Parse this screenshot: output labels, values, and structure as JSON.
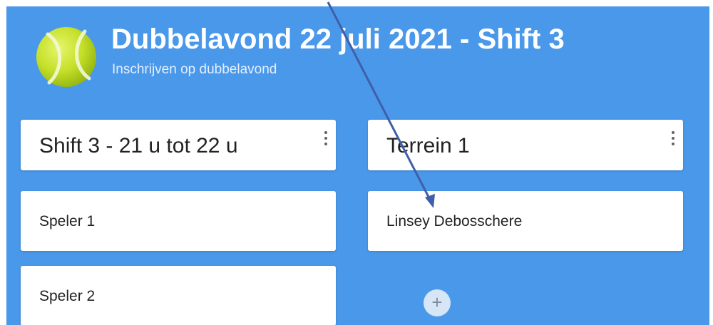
{
  "header": {
    "title": "Dubbelavond 22 juli 2021 - Shift 3",
    "subtitle": "Inschrijven op dubbelavond",
    "logo_icon": "tennis-ball-icon"
  },
  "columns": [
    {
      "title": "Shift 3 - 21 u tot 22 u",
      "menu_icon": "more-vert-icon",
      "posts": [
        "Speler 1",
        "Speler 2"
      ]
    },
    {
      "title": "Terrein 1",
      "menu_icon": "more-vert-icon",
      "posts": [
        "Linsey Debosschere"
      ],
      "add_button": "+"
    }
  ],
  "colors": {
    "board_background": "#4a98ea",
    "card": "#ffffff",
    "tennis_ball": "#c6e02a",
    "arrow": "#3f5fa8"
  }
}
